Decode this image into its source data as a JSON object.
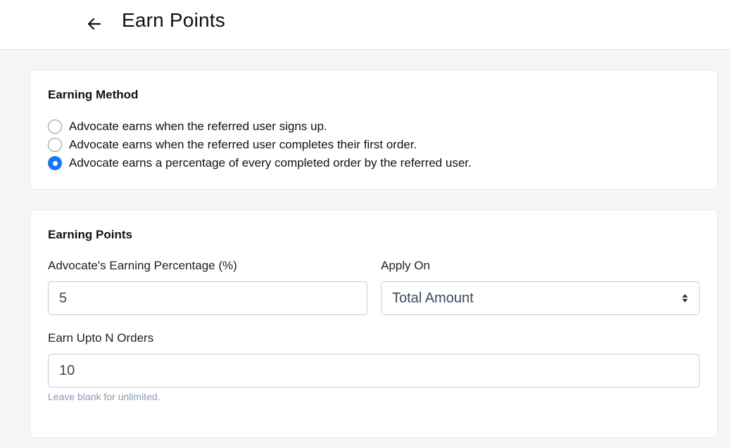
{
  "header": {
    "back_icon": "arrow-left-icon",
    "title": "Earn Points"
  },
  "earning_method": {
    "title": "Earning Method",
    "options": [
      {
        "label": "Advocate earns when the referred user signs up.",
        "checked": false
      },
      {
        "label": "Advocate earns when the referred user completes their first order.",
        "checked": false
      },
      {
        "label": "Advocate earns a percentage of every completed order by the referred user.",
        "checked": true
      }
    ],
    "accent_color": "#1877f2"
  },
  "earning_points": {
    "title": "Earning Points",
    "percentage": {
      "label": "Advocate's Earning Percentage (%)",
      "value": "5"
    },
    "apply_on": {
      "label": "Apply On",
      "selected": "Total Amount",
      "icon": "select-arrows-icon"
    },
    "orders": {
      "label": "Earn Upto N Orders",
      "value": "10",
      "help": "Leave blank for unlimited."
    }
  }
}
